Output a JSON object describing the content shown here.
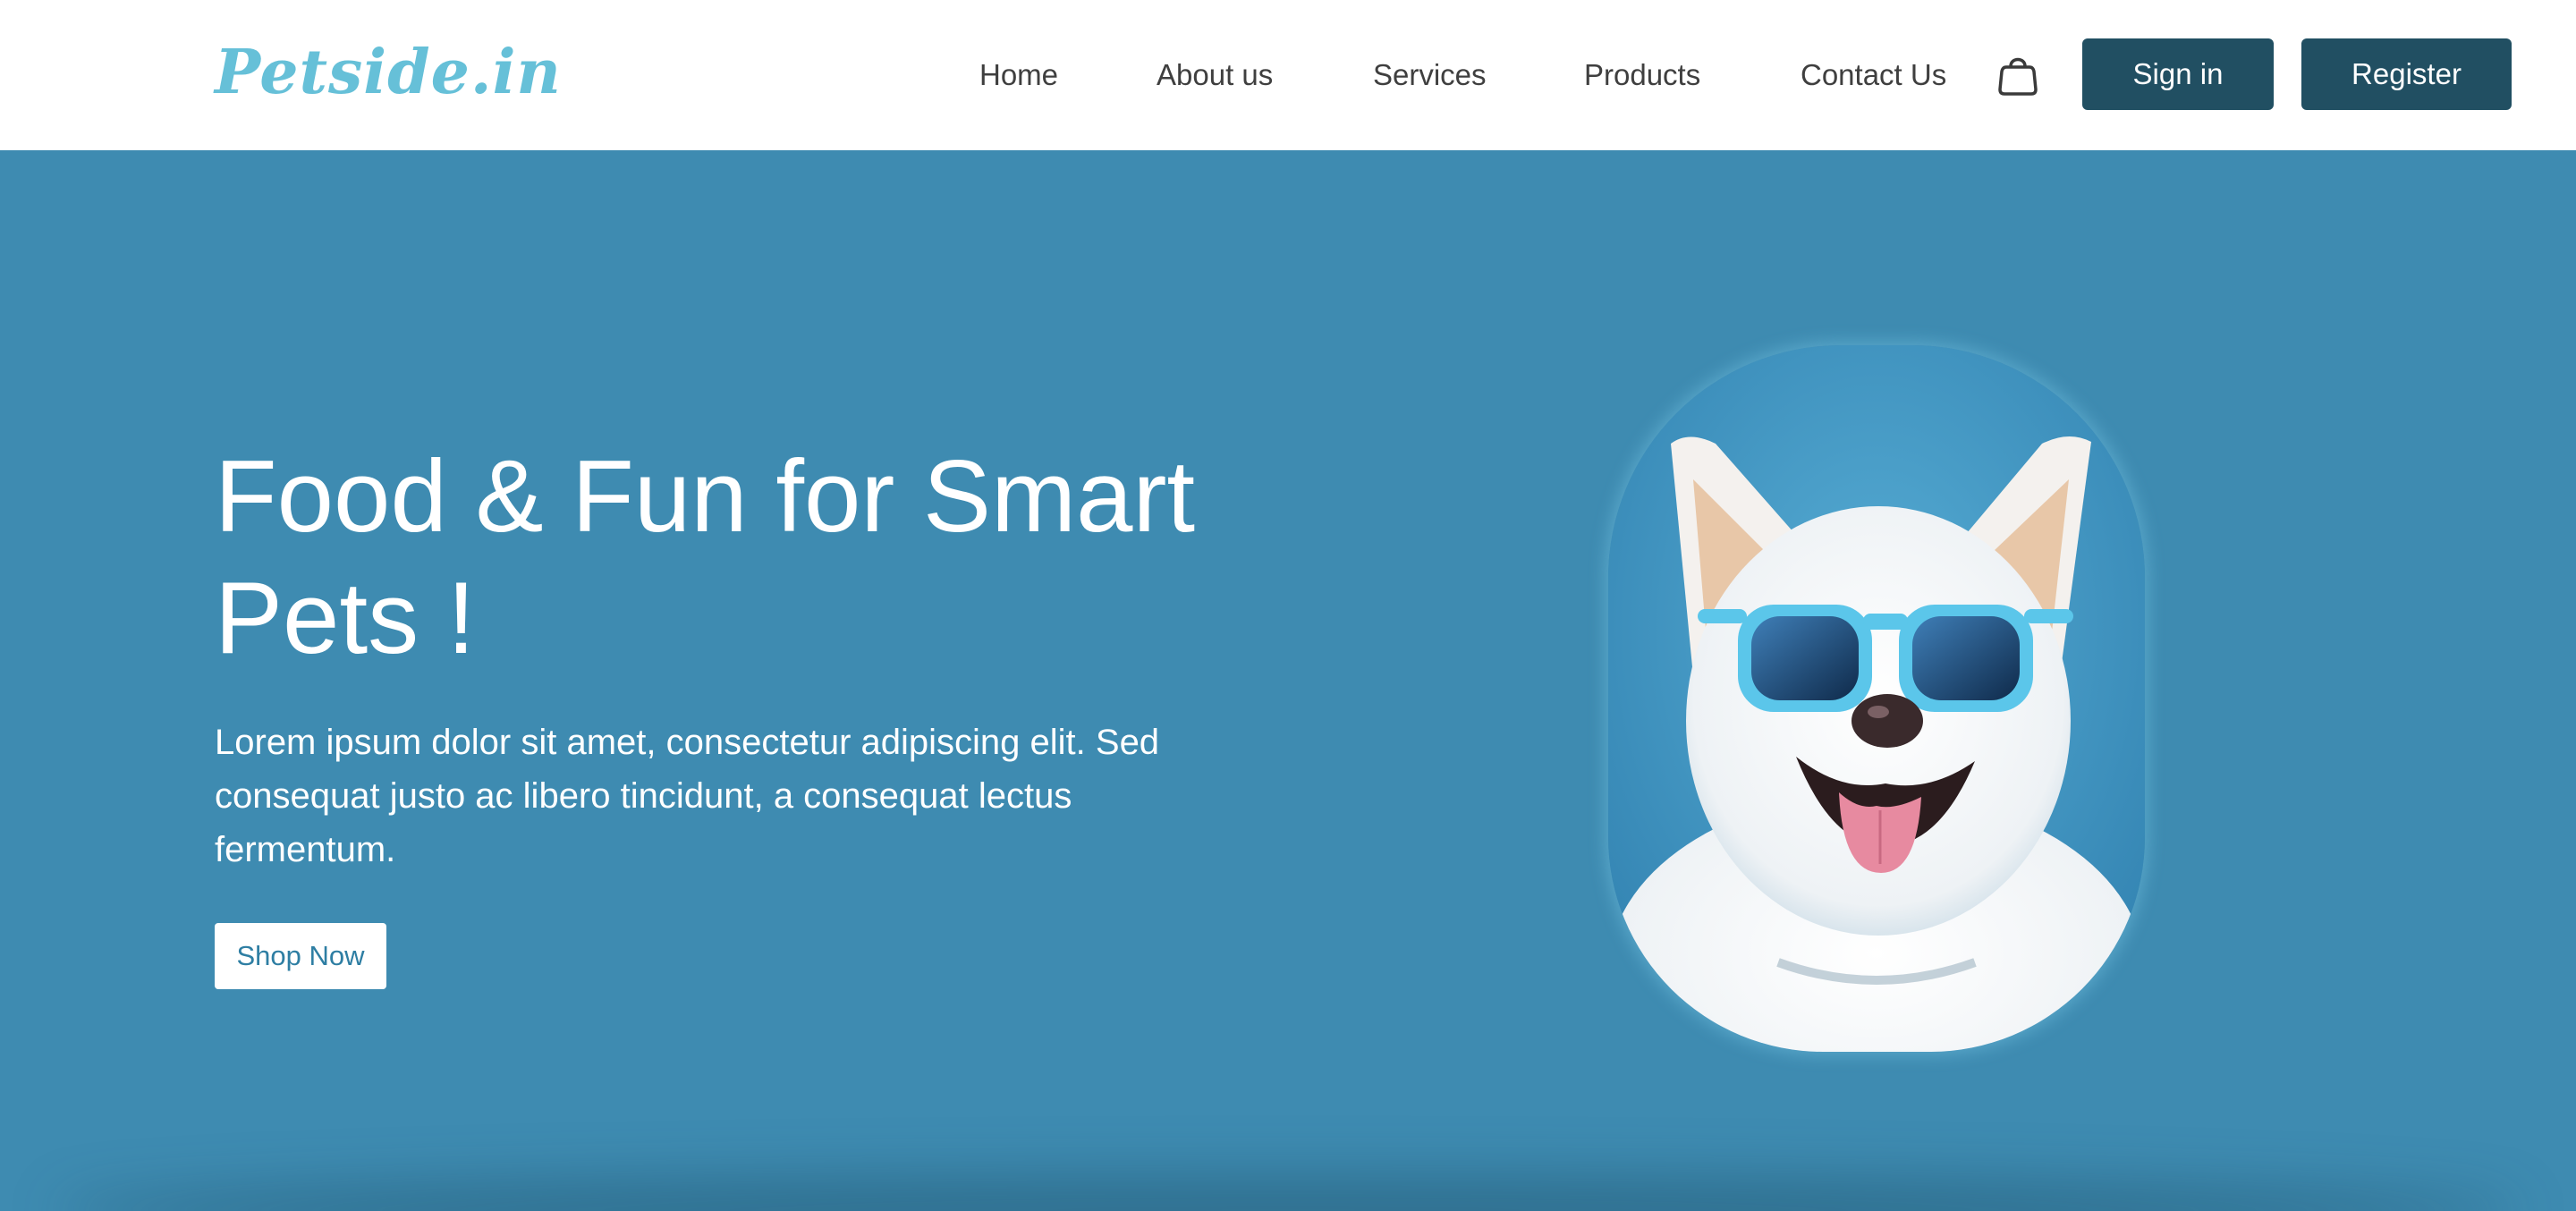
{
  "brand": {
    "logo_text": "Petside.in",
    "logo_color": "#66c0d8"
  },
  "nav": {
    "items": [
      {
        "label": "Home"
      },
      {
        "label": "About us"
      },
      {
        "label": "Services"
      },
      {
        "label": "Products"
      },
      {
        "label": "Contact Us"
      }
    ],
    "cart_icon": "shopping-bag-icon",
    "signin_label": "Sign in",
    "register_label": "Register"
  },
  "hero": {
    "title": "Food & Fun for Smart Pets !",
    "description": "Lorem ipsum dolor sit amet, consectetur adipiscing elit. Sed consequat justo ac libero tincidunt, a consequat lectus fermentum.",
    "cta_label": "Shop Now",
    "image_subject": "white dog wearing blue sunglasses"
  },
  "colors": {
    "hero_background": "#3e8bb1",
    "button_dark": "#214f62",
    "cta_text": "#2e7ea3",
    "nav_text": "#3f3f3f"
  }
}
